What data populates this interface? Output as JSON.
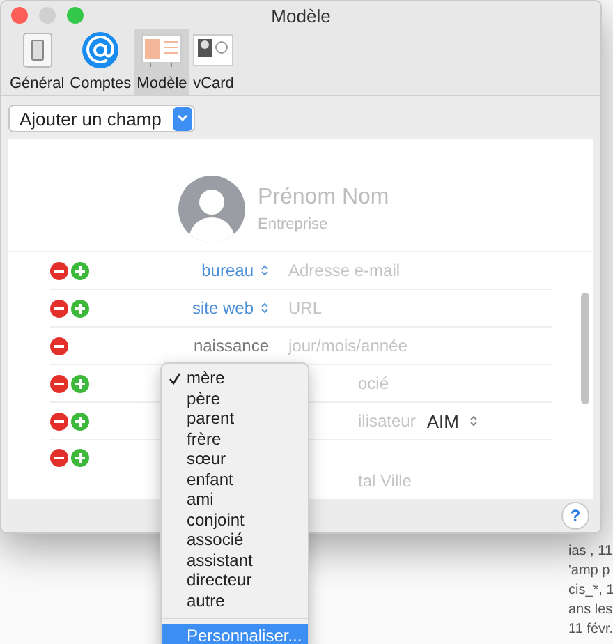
{
  "window": {
    "title": "Modèle"
  },
  "toolbar": [
    {
      "label": "Général",
      "kind": "general",
      "selected": false
    },
    {
      "label": "Comptes",
      "kind": "accounts",
      "selected": false
    },
    {
      "label": "Modèle",
      "kind": "template",
      "selected": true
    },
    {
      "label": "vCard",
      "kind": "vcard",
      "selected": false
    }
  ],
  "add_field": {
    "label": "Ajouter un champ"
  },
  "card": {
    "name": "Prénom  Nom",
    "company": "Entreprise"
  },
  "fields": [
    {
      "can_add": true,
      "label": "bureau",
      "label_popup": true,
      "placeholder": "Adresse e-mail"
    },
    {
      "can_add": true,
      "label": "site web",
      "label_popup": true,
      "placeholder": "URL"
    },
    {
      "can_add": false,
      "label": "naissance",
      "label_popup": false,
      "placeholder": "jour/mois/année"
    },
    {
      "can_add": true,
      "placeholder": "ocié"
    },
    {
      "can_add": true,
      "placeholder": "ilisateur",
      "service": "AIM"
    },
    {
      "can_add": true,
      "placeholder": "tal Ville",
      "kind": "address"
    }
  ],
  "menu": {
    "items": [
      {
        "label": "mère",
        "checked": true
      },
      {
        "label": "père",
        "checked": false
      },
      {
        "label": "parent",
        "checked": false
      },
      {
        "label": "frère",
        "checked": false
      },
      {
        "label": "sœur",
        "checked": false
      },
      {
        "label": "enfant",
        "checked": false
      },
      {
        "label": "ami",
        "checked": false
      },
      {
        "label": "conjoint",
        "checked": false
      },
      {
        "label": "associé",
        "checked": false
      },
      {
        "label": "assistant",
        "checked": false
      },
      {
        "label": "directeur",
        "checked": false
      },
      {
        "label": "autre",
        "checked": false
      }
    ],
    "footer_item": {
      "label": "Personnaliser...",
      "highlighted": true
    }
  },
  "help": {
    "label": "?"
  },
  "background_text": [
    "ias , 11",
    "'amp p",
    "cis_*, 1",
    "ans les",
    "11 févr."
  ]
}
